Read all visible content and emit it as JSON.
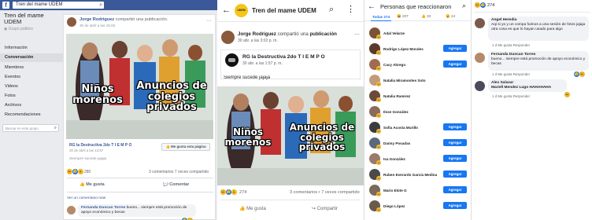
{
  "panel1": {
    "search_value": "Tren del mame UDEM",
    "group_name": "Tren del mame UDEM",
    "group_type": "Grupo público",
    "nav": [
      "Información",
      "Conversación",
      "Miembros",
      "Eventos",
      "Videos",
      "Fotos",
      "Archivos",
      "Recomendaciones"
    ],
    "group_search_placeholder": "Buscar en este grupo",
    "post": {
      "author": "Jorge Rodriguez",
      "action": "compartió una publicación.",
      "time": "30 de abril a las 15:02",
      "meme_left": "Niños morenos",
      "meme_right": "Anuncios de colegios privados",
      "shared_name": "RG la Destructiva 2do T I E M P O",
      "shared_time": "30 de abril a las 13:57",
      "shared_text": "Siempre sucede jajaja",
      "like_page_btn": "Me gusta esta página",
      "reaction_count": "280",
      "comments_shares": "3 comentarios  7 veces compartido",
      "like_btn": "Me gusta",
      "comment_btn": "Comentar",
      "view_more": "Ver un comentario más",
      "comment_author": "Fernanda Duncan Torres",
      "comment_text": "bueno... siempre está promoción de apoyo económico y becas"
    }
  },
  "panel2": {
    "title": "Tren del mame UDEM",
    "author": "Jorge Rodriguez",
    "action": "compartió una",
    "action_link": "publicación",
    "time": "30 abr. a las 3:02 p. m.",
    "shared_name": "RG la Destructiva 2do T I E M P O",
    "shared_time": "30 abr. a las 1:57 p. m.",
    "shared_text": "Siempre sucede jajaja",
    "meme_left": "Niños morenos",
    "meme_right": "Anuncios de colegios privados",
    "reaction_count": "274",
    "comments_shares": "3 comentarios • 7 veces compartido",
    "like_btn": "Me gusta",
    "share_btn": "Compartir"
  },
  "panel3": {
    "title": "Personas que reaccionaron",
    "tabs": [
      {
        "label": "Todas 274"
      },
      {
        "label": "207"
      },
      {
        "label": "33"
      },
      {
        "label": "24"
      }
    ],
    "add_label": "Agregar",
    "people": [
      {
        "name": "Adal Velarze",
        "btn": false,
        "color": "#7a5236"
      },
      {
        "name": "Rodrigo López Morales",
        "btn": true,
        "color": "#5b3a2a"
      },
      {
        "name": "Cacy Abrego",
        "btn": true,
        "color": "#a06c4f"
      },
      {
        "name": "Natalia Miramontes Soto",
        "btn": false,
        "color": "#c49a7c"
      },
      {
        "name": "Natalia Ramirez",
        "btn": false,
        "color": "#6b4a3a"
      },
      {
        "name": "Ilsse González",
        "btn": false,
        "color": "#8a6a5a"
      },
      {
        "name": "Sofia Acosta Murillo",
        "btn": true,
        "color": "#3b3b3b"
      },
      {
        "name": "Danny Posadas",
        "btn": true,
        "color": "#5a6a7a"
      },
      {
        "name": "Isa González",
        "btn": true,
        "color": "#9a7a6a"
      },
      {
        "name": "Ruben Everardo García Medina",
        "btn": true,
        "color": "#4a4a4a"
      },
      {
        "name": "Mario Elote G",
        "btn": true,
        "color": "#7a6a5a"
      },
      {
        "name": "Diego López",
        "btn": true,
        "color": "#6a5a4a"
      }
    ]
  },
  "panel4": {
    "reaction_count": "274",
    "comments": [
      {
        "author": "Angel Heredia",
        "text": "Aqi si yo y un compa fuimos a una sesión de fotos jajaja otra cosa es que lo hayan usado para algo",
        "meta": "1 d   Me gusta   Responder"
      },
      {
        "author": "Fernanda Duncan Torres",
        "text": "bueno... siempre está promoción de apoyo económico y becas",
        "meta": "1 d   Me gusta   Responder"
      },
      {
        "author": "Alex Salazar",
        "text": "Mariell Mendez Lugo HAHAHAHA",
        "meta": "1 d   Me gusta   Responder"
      }
    ]
  }
}
